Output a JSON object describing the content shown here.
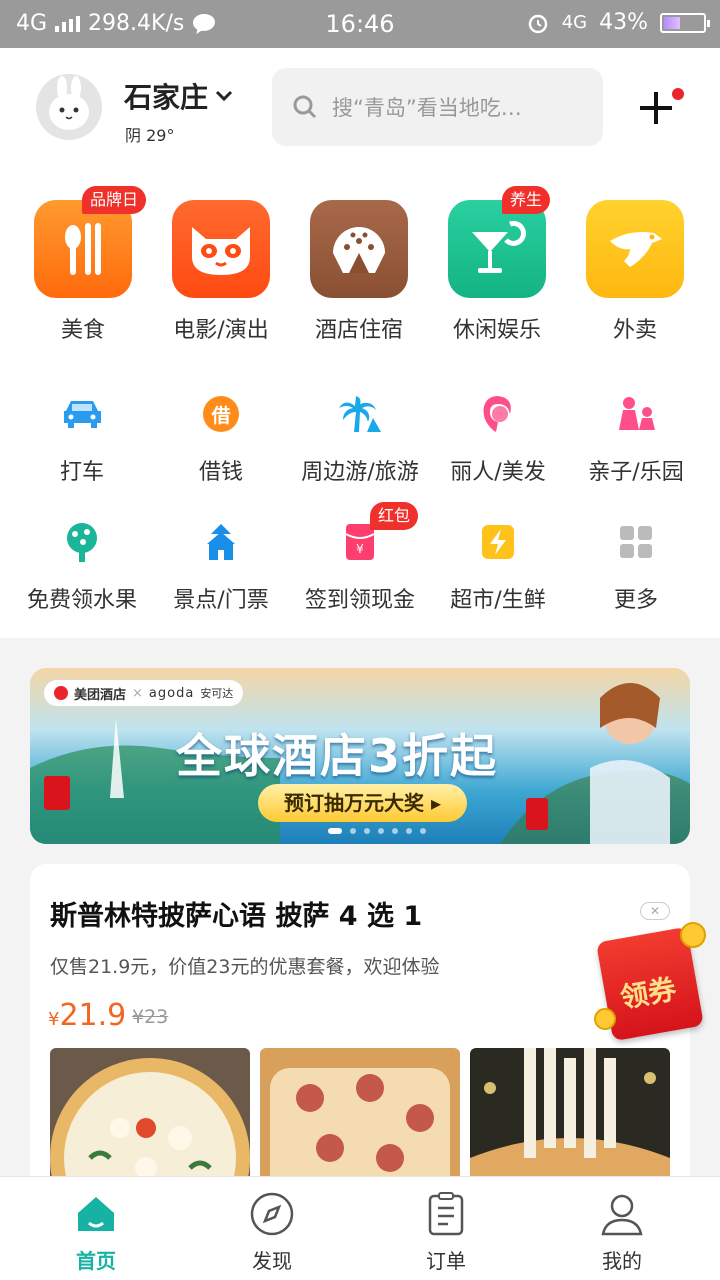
{
  "status_bar": {
    "network": "4G",
    "speed": "298.4K/s",
    "time": "16:46",
    "network2": "4G",
    "battery": "43%",
    "battery_level": 0.43
  },
  "header": {
    "city": "石家庄",
    "weather": "阴 29°",
    "search_placeholder": "搜“青岛”看当地吃…"
  },
  "main_categories": [
    {
      "label": "美食",
      "badge": "品牌日",
      "icon": "fork-knife-icon",
      "color": "#ff7a1a"
    },
    {
      "label": "电影/演出",
      "badge": "",
      "icon": "cat-face-icon",
      "color": "#ff5a1f"
    },
    {
      "label": "酒店住宿",
      "badge": "",
      "icon": "hotel-bun-icon",
      "color": "#9a5a3a"
    },
    {
      "label": "休闲娱乐",
      "badge": "养生",
      "icon": "cocktail-icon",
      "color": "#19c28f"
    },
    {
      "label": "外卖",
      "badge": "",
      "icon": "kangaroo-icon",
      "color": "#ffc21a"
    }
  ],
  "sub_categories_row1": [
    {
      "label": "打车",
      "icon": "taxi-icon"
    },
    {
      "label": "借钱",
      "icon": "loan-icon",
      "glyph": "借"
    },
    {
      "label": "周边游/旅游",
      "icon": "palm-tree-icon"
    },
    {
      "label": "丽人/美发",
      "icon": "woman-hair-icon"
    },
    {
      "label": "亲子/乐园",
      "icon": "parent-child-icon"
    }
  ],
  "sub_categories_row2": [
    {
      "label": "免费领水果",
      "icon": "fruit-tree-icon",
      "badge": ""
    },
    {
      "label": "景点/门票",
      "icon": "pagoda-icon",
      "badge": ""
    },
    {
      "label": "签到领现金",
      "icon": "red-envelope-icon",
      "badge": "红包"
    },
    {
      "label": "超市/生鲜",
      "icon": "lightning-icon",
      "badge": ""
    },
    {
      "label": "更多",
      "icon": "grid-more-icon",
      "badge": ""
    }
  ],
  "banner": {
    "brand": "美团酒店",
    "partner": "agoda",
    "partner_cn": "安可达",
    "headline": "全球酒店3折起",
    "cta": "预订抽万元大奖 ▸"
  },
  "deal": {
    "title": "斯普林特披萨心语 披萨 4 选 1",
    "desc": "仅售21.9元，价值23元的优惠套餐，欢迎体验",
    "currency": "¥",
    "price": "21.9",
    "orig_price": "¥23"
  },
  "coupon": {
    "label": "领券"
  },
  "tabs": [
    {
      "label": "首页",
      "icon": "home-icon",
      "active": true
    },
    {
      "label": "发现",
      "icon": "compass-icon",
      "active": false
    },
    {
      "label": "订单",
      "icon": "order-list-icon",
      "active": false
    },
    {
      "label": "我的",
      "icon": "profile-icon",
      "active": false
    }
  ],
  "colors": {
    "accent": "#17b2a4",
    "price": "#f26522",
    "badge": "#f0302a"
  }
}
